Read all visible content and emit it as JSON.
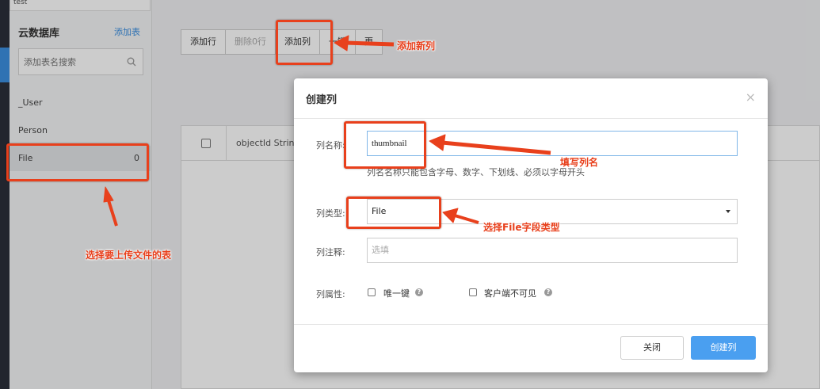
{
  "sidebar": {
    "project_name": "test",
    "title": "云数据库",
    "add_table_label": "添加表",
    "search_placeholder": "添加表名搜索",
    "items": [
      {
        "label": "_User",
        "count": ""
      },
      {
        "label": "Person",
        "count": ""
      },
      {
        "label": "File",
        "count": "0"
      }
    ]
  },
  "toolbar": {
    "add_row": "添加行",
    "delete_rows": "删除0行",
    "add_column": "添加列",
    "hidden_button": "一键",
    "more": "更"
  },
  "table": {
    "column_header": "objectId  String"
  },
  "modal": {
    "title": "创建列",
    "close_glyph": "×",
    "column_name_label": "列名称:",
    "column_name_value": "thumbnail",
    "column_name_hint": "列名名称只能包含字母、数字、下划线、必须以字母开头",
    "column_type_label": "列类型:",
    "column_type_value": "File",
    "column_comment_label": "列注释:",
    "column_comment_placeholder": "选填",
    "column_attr_label": "列属性:",
    "unique_key_label": "唯一键",
    "client_invisible_label": "客户端不可见",
    "cancel_label": "关闭",
    "create_label": "创建列"
  },
  "annotations": {
    "add_column_note": "添加新列",
    "column_name_note": "填写列名",
    "column_type_note": "选择File字段类型",
    "table_note": "选择要上传文件的表",
    "color": "#e8401c"
  }
}
